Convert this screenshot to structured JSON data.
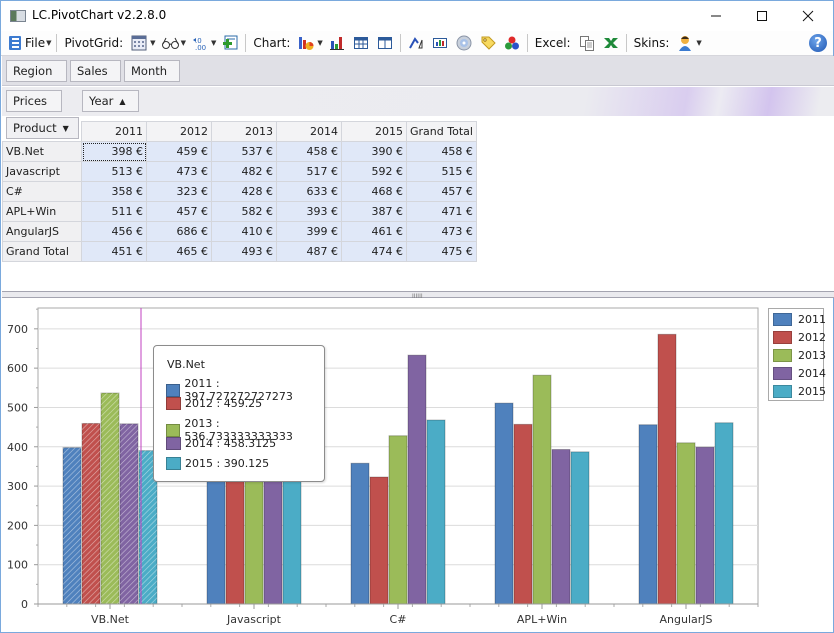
{
  "window": {
    "title": "LC.PivotChart v2.2.8.0",
    "controls": {
      "minimize": "—",
      "maximize": "☐",
      "close": "✕"
    }
  },
  "toolbar": {
    "file_label": "File",
    "pivotgrid_label": "PivotGrid:",
    "chart_label": "Chart:",
    "excel_label": "Excel:",
    "skins_label": "Skins:",
    "help_glyph": "?",
    "pivotgrid_icons": [
      "grid-format-icon",
      "view-glasses-icon",
      "decimal-format-icon",
      "add-field-icon"
    ],
    "chart_icons": [
      "chart-type-icon",
      "bar-chart-icon",
      "table-icon",
      "split-view-icon",
      "rotate-axes-icon",
      "chart-labels-icon",
      "disc-icon",
      "tag-icon",
      "palette-icon"
    ],
    "excel_icons": [
      "copy-icon",
      "excel-export-icon"
    ],
    "skin_icon": "user-skin-icon"
  },
  "pivot": {
    "filter_fields": [
      "Region",
      "Sales",
      "Month"
    ],
    "data_field": "Prices",
    "column_field": {
      "label": "Year",
      "sort": "▲"
    },
    "row_field": {
      "label": "Product",
      "sort": "▼"
    },
    "columns": [
      "2011",
      "2012",
      "2013",
      "2014",
      "2015",
      "Grand Total"
    ],
    "rows": [
      {
        "label": "VB.Net",
        "values": [
          "398 €",
          "459 €",
          "537 €",
          "458 €",
          "390 €",
          "458 €"
        ]
      },
      {
        "label": "Javascript",
        "values": [
          "513 €",
          "473 €",
          "482 €",
          "517 €",
          "592 €",
          "515 €"
        ]
      },
      {
        "label": "C#",
        "values": [
          "358 €",
          "323 €",
          "428 €",
          "633 €",
          "468 €",
          "457 €"
        ]
      },
      {
        "label": "APL+Win",
        "values": [
          "511 €",
          "457 €",
          "582 €",
          "393 €",
          "387 €",
          "471 €"
        ]
      },
      {
        "label": "AngularJS",
        "values": [
          "456 €",
          "686 €",
          "410 €",
          "399 €",
          "461 €",
          "473 €"
        ]
      },
      {
        "label": "Grand Total",
        "values": [
          "451 €",
          "465 €",
          "493 €",
          "487 €",
          "474 €",
          "475 €"
        ]
      }
    ]
  },
  "splitter_grip": "IIIIII",
  "tooltip": {
    "title": "VB.Net",
    "rows": [
      "2011 : 397.727272727273",
      "2012 : 459.25",
      "2013 : 536.733333333333",
      "2014 : 458.3125",
      "2015 : 390.125"
    ]
  },
  "colors": {
    "2011": "#4f81bd",
    "2012": "#c0504d",
    "2013": "#9bbb59",
    "2014": "#8064a2",
    "2015": "#4bacc6",
    "cursor_line": "#c040c0"
  },
  "chart_data": {
    "type": "bar",
    "title": "",
    "xlabel": "",
    "ylabel": "",
    "categories": [
      "VB.Net",
      "Javascript",
      "C#",
      "APL+Win",
      "AngularJS"
    ],
    "series": [
      {
        "name": "2011",
        "values": [
          397.73,
          513,
          358,
          511,
          456
        ]
      },
      {
        "name": "2012",
        "values": [
          459.25,
          473,
          323,
          457,
          686
        ]
      },
      {
        "name": "2013",
        "values": [
          536.73,
          482,
          428,
          582,
          410
        ]
      },
      {
        "name": "2014",
        "values": [
          458.31,
          517,
          633,
          393,
          399
        ]
      },
      {
        "name": "2015",
        "values": [
          390.13,
          592,
          468,
          387,
          461
        ]
      }
    ],
    "yticks": [
      0,
      100,
      200,
      300,
      400,
      500,
      600,
      700
    ],
    "ylim": [
      0,
      753
    ],
    "grid": true,
    "legend": "right",
    "highlighted_category": "VB.Net"
  }
}
